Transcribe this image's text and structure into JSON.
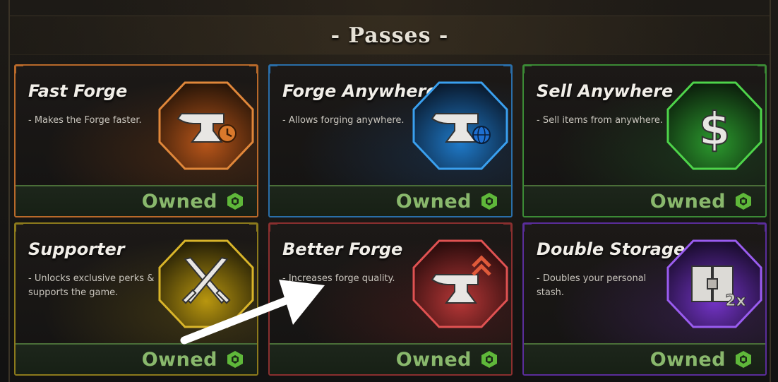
{
  "header": {
    "title": "- Passes -"
  },
  "colors": {
    "owned_text": "#89b86c",
    "owned_border": "#4a6e38",
    "robux_icon": "#5fb83a"
  },
  "passes": [
    {
      "name": "Fast Forge",
      "description": "- Makes the Forge faster.",
      "status": "Owned",
      "theme": "orange",
      "accent": "#c9772a",
      "icon": "anvil-clock-icon"
    },
    {
      "name": "Forge Anywhere",
      "description": "- Allows forging anywhere.",
      "status": "Owned",
      "theme": "blue",
      "accent": "#2a8bd6",
      "icon": "anvil-globe-icon"
    },
    {
      "name": "Sell Anywhere",
      "description": "- Sell items from anywhere.",
      "status": "Owned",
      "theme": "green",
      "accent": "#3fae3a",
      "icon": "dollar-icon"
    },
    {
      "name": "Supporter",
      "description": "- Unlocks exclusive perks & supports the game.",
      "status": "Owned",
      "theme": "gold",
      "accent": "#b8961e",
      "icon": "crossed-swords-icon"
    },
    {
      "name": "Better Forge",
      "description": "- Increases forge quality.",
      "status": "Owned",
      "theme": "red",
      "accent": "#c23a3a",
      "icon": "anvil-upgrade-icon"
    },
    {
      "name": "Double Storage",
      "description": "- Doubles your personal stash.",
      "status": "Owned",
      "theme": "purple",
      "accent": "#7d3fcf",
      "icon": "double-chest-icon",
      "badge": "2x"
    }
  ]
}
